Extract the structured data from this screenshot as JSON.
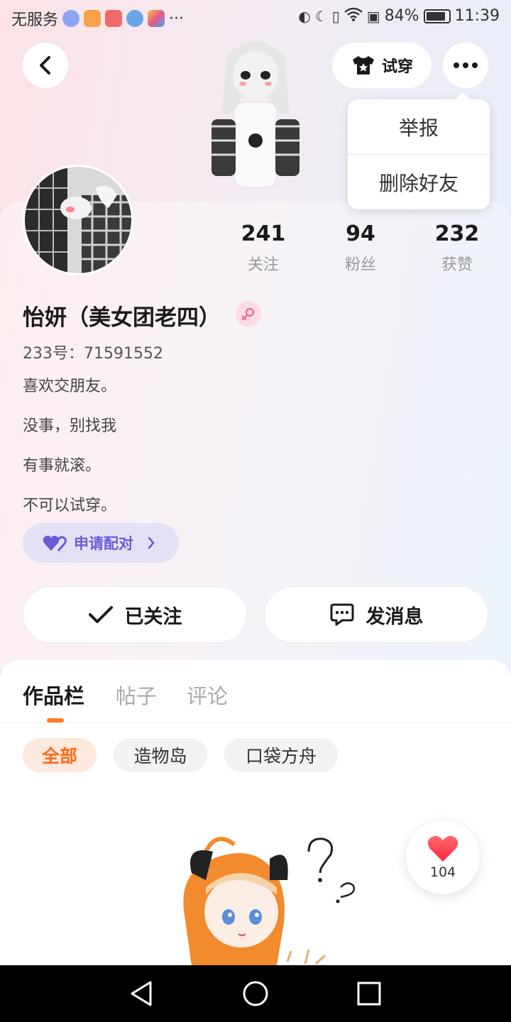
{
  "status_bar": {
    "carrier": "无服务",
    "battery": "84%",
    "time": "11:39"
  },
  "header": {
    "tryon_label": "试穿"
  },
  "more_menu": {
    "items": [
      "举报",
      "删除好友"
    ]
  },
  "profile": {
    "stats": [
      {
        "value": "241",
        "label": "关注"
      },
      {
        "value": "94",
        "label": "粉丝"
      },
      {
        "value": "232",
        "label": "获赞"
      }
    ],
    "name": "怡妍（美女团老四）",
    "uid": "233号：71591552",
    "bio": [
      "喜欢交朋友。",
      "没事，别找我",
      "有事就滚。",
      "不可以试穿。"
    ],
    "pair_button": "申请配对",
    "follow_button": "已关注",
    "message_button": "发消息"
  },
  "tabs": [
    "作品栏",
    "帖子",
    "评论"
  ],
  "filters": [
    "全部",
    "造物岛",
    "口袋方舟"
  ],
  "like_count": "104",
  "colors": {
    "accent": "#ff7a1a",
    "pair": "#6b5bd6",
    "heart": "#ff3b4e"
  }
}
